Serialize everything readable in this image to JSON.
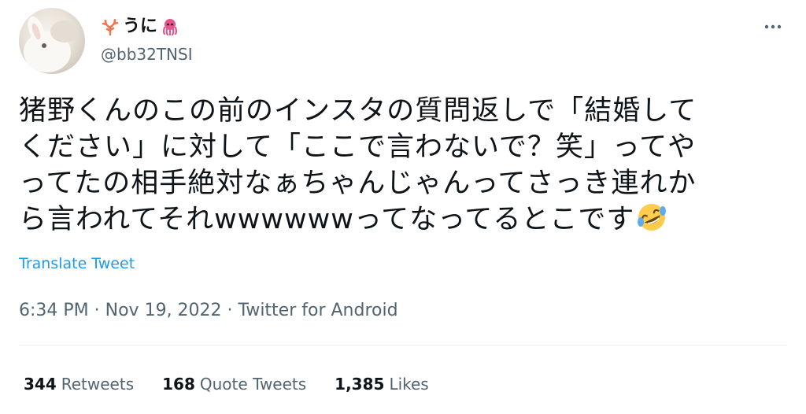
{
  "author": {
    "display_name": "うに",
    "handle": "@bb32TNSI",
    "name_emoji_left": "coral-icon",
    "name_emoji_right": "octopus-icon"
  },
  "tweet": {
    "lines": [
      "猪野くんのこの前のインスタの質問返しで「結婚して",
      "ください」に対して「ここで言わないで？笑」ってや",
      "ってたの相手絶対なぁちゃんじゃんってさっき連れか",
      "ら言われてそれwwwwwwってなってるとこです"
    ],
    "trailing_emoji": "rolling-on-floor-laughing-icon"
  },
  "translate_label": "Translate Tweet",
  "meta": {
    "time": "6:34 PM",
    "sep": " · ",
    "date": "Nov 19, 2022",
    "client": "Twitter for Android"
  },
  "stats": {
    "retweets_count": "344",
    "retweets_label": "Retweets",
    "quotes_count": "168",
    "quotes_label": "Quote Tweets",
    "likes_count": "1,385",
    "likes_label": "Likes"
  },
  "colors": {
    "text": "#0f1419",
    "secondary": "#536471",
    "link": "#1d9bf0",
    "divider": "#eff3f4"
  }
}
